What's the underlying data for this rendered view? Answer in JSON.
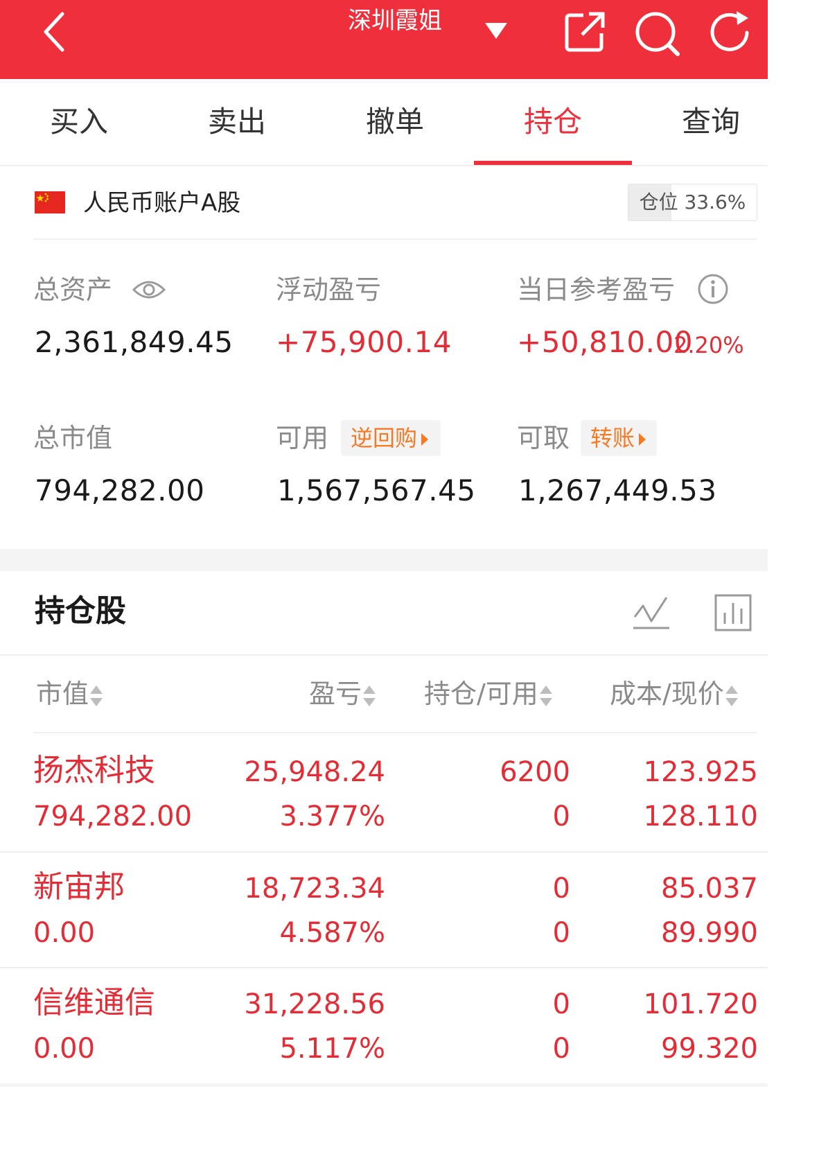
{
  "header": {
    "title": "深圳霞姐",
    "colors": {
      "brand_red": "#ef2f3b",
      "gain_red": "#e32c36",
      "chip_orange": "#f47a26"
    },
    "icons": [
      "back-icon",
      "chevron-down-icon",
      "share-icon",
      "search-icon",
      "refresh-icon"
    ]
  },
  "tabs": [
    {
      "label": "买入",
      "active": false
    },
    {
      "label": "卖出",
      "active": false
    },
    {
      "label": "撤单",
      "active": false
    },
    {
      "label": "持仓",
      "active": true
    },
    {
      "label": "查询",
      "active": false
    }
  ],
  "account": {
    "label": "人民币账户A股",
    "position_label": "仓位 33.6%",
    "position_ratio": 0.336
  },
  "summary": {
    "total_assets": {
      "label": "总资产",
      "value": "2,361,849.45"
    },
    "floating_pl": {
      "label": "浮动盈亏",
      "value": "+75,900.14"
    },
    "daily_pl": {
      "label": "当日参考盈亏",
      "value": "+50,810.00",
      "pct": "2.20%"
    },
    "market_value": {
      "label": "总市值",
      "value": "794,282.00"
    },
    "available": {
      "label": "可用",
      "chip": "逆回购",
      "value": "1,567,567.45"
    },
    "withdrawable": {
      "label": "可取",
      "chip": "转账",
      "value": "1,267,449.53"
    }
  },
  "holdings": {
    "title": "持仓股",
    "columns": [
      "市值",
      "盈亏",
      "持仓/可用",
      "成本/现价"
    ],
    "rows": [
      {
        "name": "扬杰科技",
        "market_value": "794,282.00",
        "pl": "25,948.24",
        "pl_pct": "3.377%",
        "holding": "6200",
        "available": "0",
        "cost": "123.925",
        "price": "128.110"
      },
      {
        "name": "新宙邦",
        "market_value": "0.00",
        "pl": "18,723.34",
        "pl_pct": "4.587%",
        "holding": "0",
        "available": "0",
        "cost": "85.037",
        "price": "89.990"
      },
      {
        "name": "信维通信",
        "market_value": "0.00",
        "pl": "31,228.56",
        "pl_pct": "5.117%",
        "holding": "0",
        "available": "0",
        "cost": "101.720",
        "price": "99.320"
      }
    ]
  }
}
